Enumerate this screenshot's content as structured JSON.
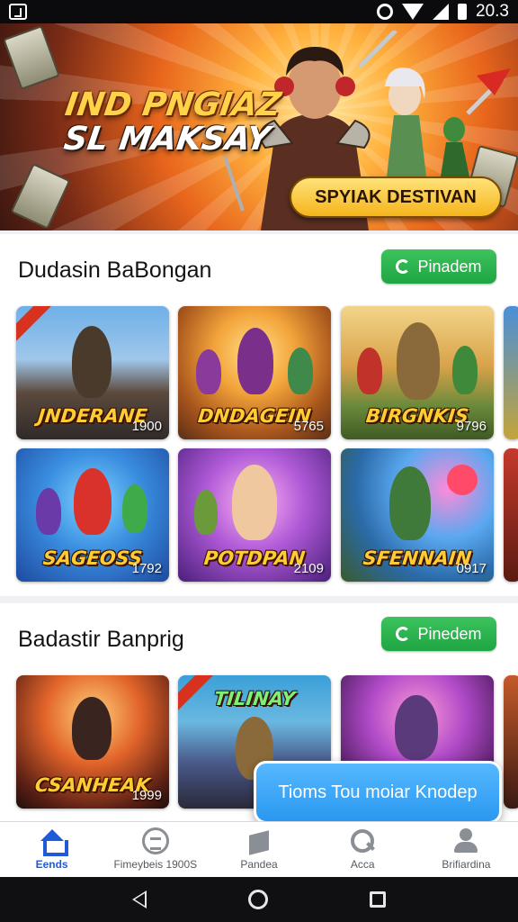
{
  "status_bar": {
    "time": "20.3",
    "icons": [
      "app-icon",
      "gear-icon",
      "wifi-icon",
      "signal-icon",
      "battery-icon"
    ]
  },
  "hero": {
    "title_line1": "IND PNGIAZ",
    "title_line2": "SL MAKSAY",
    "cta_label": "SPYIAK DESTIVAN"
  },
  "sections": [
    {
      "title": "Dudasin BaBongan",
      "button_label": "Pinadem",
      "button_icon": "refresh-icon",
      "games": [
        {
          "name": "JNDERANE",
          "number": "1900"
        },
        {
          "name": "DNDAGEIN",
          "number": "5765"
        },
        {
          "name": "BIRGNKIS",
          "number": "9796"
        },
        {
          "name": "SAGEOSS",
          "number": "1792"
        },
        {
          "name": "POTDPAN",
          "number": "2109"
        },
        {
          "name": "SFENNAIN",
          "number": "0917"
        }
      ]
    },
    {
      "title": "Badastir Banprig",
      "button_label": "Pinedem",
      "button_icon": "refresh-icon",
      "games": [
        {
          "name": "CSANHEAK",
          "number": "1999"
        },
        {
          "name": "TILINAY",
          "number": ""
        },
        {
          "name": "",
          "number": ""
        }
      ]
    }
  ],
  "toast": {
    "text": "Tioms Tou moiar Knodep"
  },
  "bottom_nav": [
    {
      "label": "Eends",
      "icon": "home-icon",
      "active": true
    },
    {
      "label": "Fimeybeis 1900S",
      "icon": "sheets-icon",
      "active": false
    },
    {
      "label": "Pandea",
      "icon": "box-icon",
      "active": false
    },
    {
      "label": "Acca",
      "icon": "search-icon",
      "active": false
    },
    {
      "label": "Brifiardina",
      "icon": "person-icon",
      "active": false
    }
  ],
  "colors": {
    "accent_green": "#22a847",
    "nav_active": "#1f5bd8",
    "toast_blue": "#3aa6f5",
    "hero_gold": "#ffd24a"
  }
}
